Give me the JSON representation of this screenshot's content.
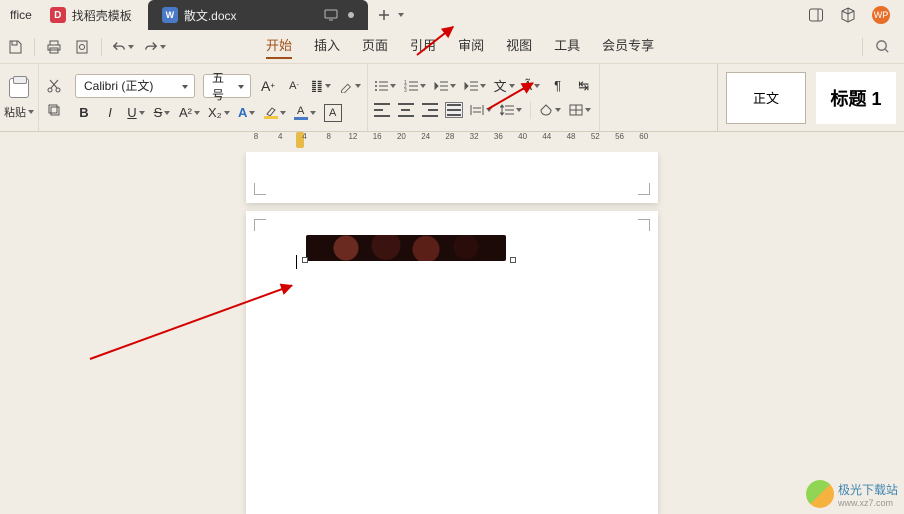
{
  "tabs": {
    "home_label": "ffice",
    "template_label": "找稻壳模板",
    "doc_label": "散文.docx",
    "doc_icon": "W",
    "template_icon": "D"
  },
  "avatar_text": "WP",
  "menu": {
    "items": [
      "开始",
      "插入",
      "页面",
      "引用",
      "审阅",
      "视图",
      "工具",
      "会员专享"
    ],
    "active_index": 0
  },
  "font": {
    "name": "Calibri (正文)",
    "size": "五号"
  },
  "toolbar": {
    "paste_label": "粘贴",
    "bold": "B",
    "italic": "I",
    "underline": "U",
    "strike": "S",
    "letter_A": "A",
    "super": "A²",
    "sub": "X₂"
  },
  "styles": {
    "normal": "正文",
    "heading1": "标题 1"
  },
  "ruler": {
    "numbers": [
      8,
      4,
      4,
      8,
      12,
      16,
      20,
      24,
      28,
      32,
      36,
      40,
      44,
      48,
      52,
      56,
      60
    ]
  },
  "watermark": {
    "text": "极光下载站",
    "url": "www.xz7.com"
  }
}
